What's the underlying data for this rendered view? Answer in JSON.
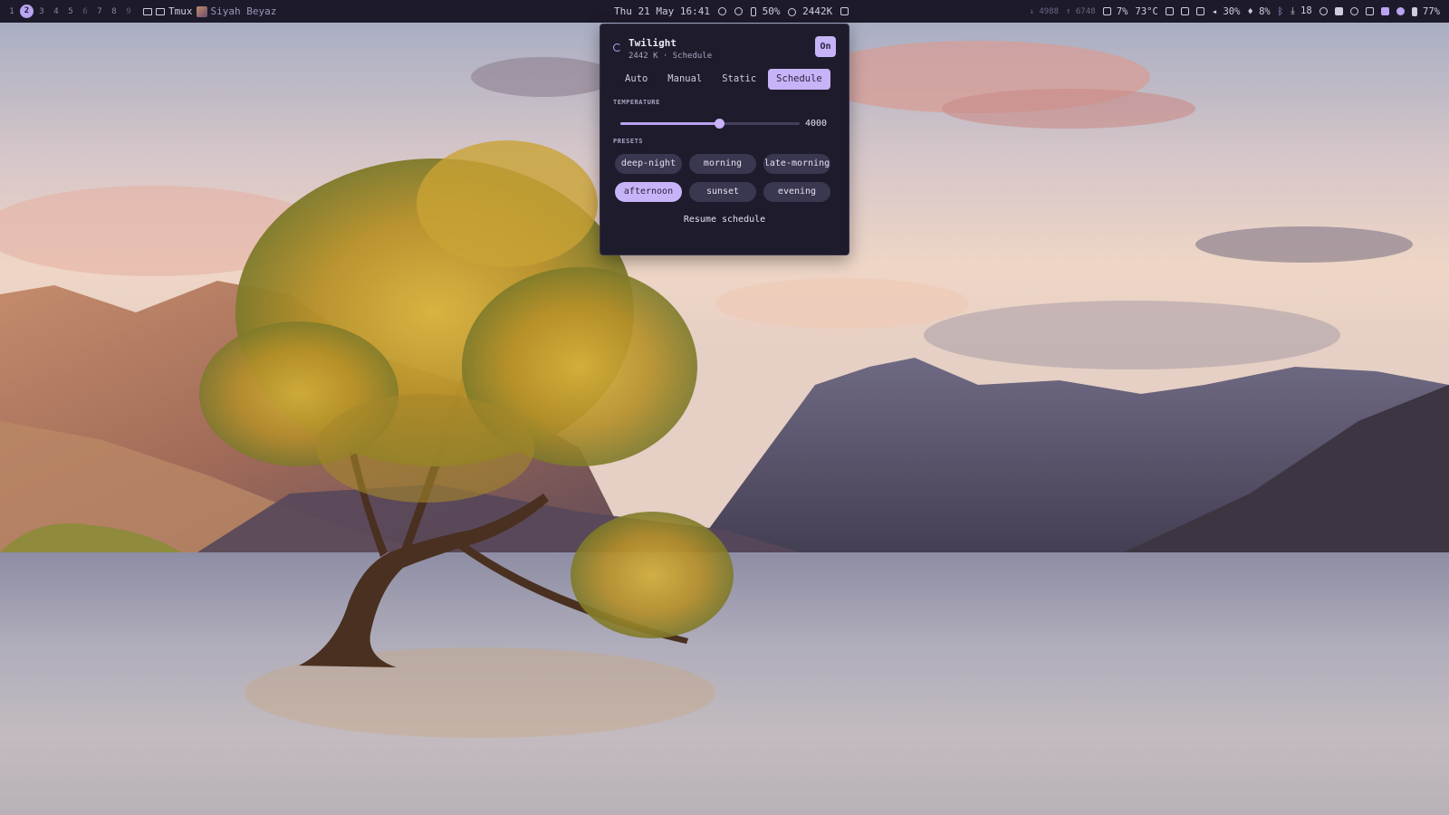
{
  "topbar": {
    "workspaces": [
      {
        "label": "1",
        "state": "normal"
      },
      {
        "label": "2",
        "state": "active"
      },
      {
        "label": "3",
        "state": "normal"
      },
      {
        "label": "4",
        "state": "normal"
      },
      {
        "label": "5",
        "state": "normal"
      },
      {
        "label": "6",
        "state": "dim"
      },
      {
        "label": "7",
        "state": "normal"
      },
      {
        "label": "8",
        "state": "normal"
      },
      {
        "label": "9",
        "state": "dim"
      }
    ],
    "window_app": "Tmux",
    "window_title": "Siyah Beyaz",
    "clock": "Thu 21 May 16:41",
    "battery_center": "50%",
    "temperature_center": "2442K",
    "net_down": "↓ 4988",
    "net_up": "↑ 6748",
    "cpu": "7%",
    "cpu_temp": "73°C",
    "volume": "30%",
    "mic": "8%",
    "updates": "18",
    "battery": "77%"
  },
  "twilight": {
    "title": "Twilight",
    "subtitle": "2442 K · Schedule",
    "toggle_label": "On",
    "modes": [
      "Auto",
      "Manual",
      "Static",
      "Schedule"
    ],
    "active_mode": "Schedule",
    "temperature_label": "TEMPERATURE",
    "temperature_value": "4000",
    "temperature_fraction": 0.55,
    "presets_label": "PRESETS",
    "presets": [
      "deep-night",
      "morning",
      "late-morning",
      "afternoon",
      "sunset",
      "evening"
    ],
    "active_preset": "afternoon",
    "resume_label": "Resume schedule",
    "accent_color": "#c7b3f7"
  }
}
